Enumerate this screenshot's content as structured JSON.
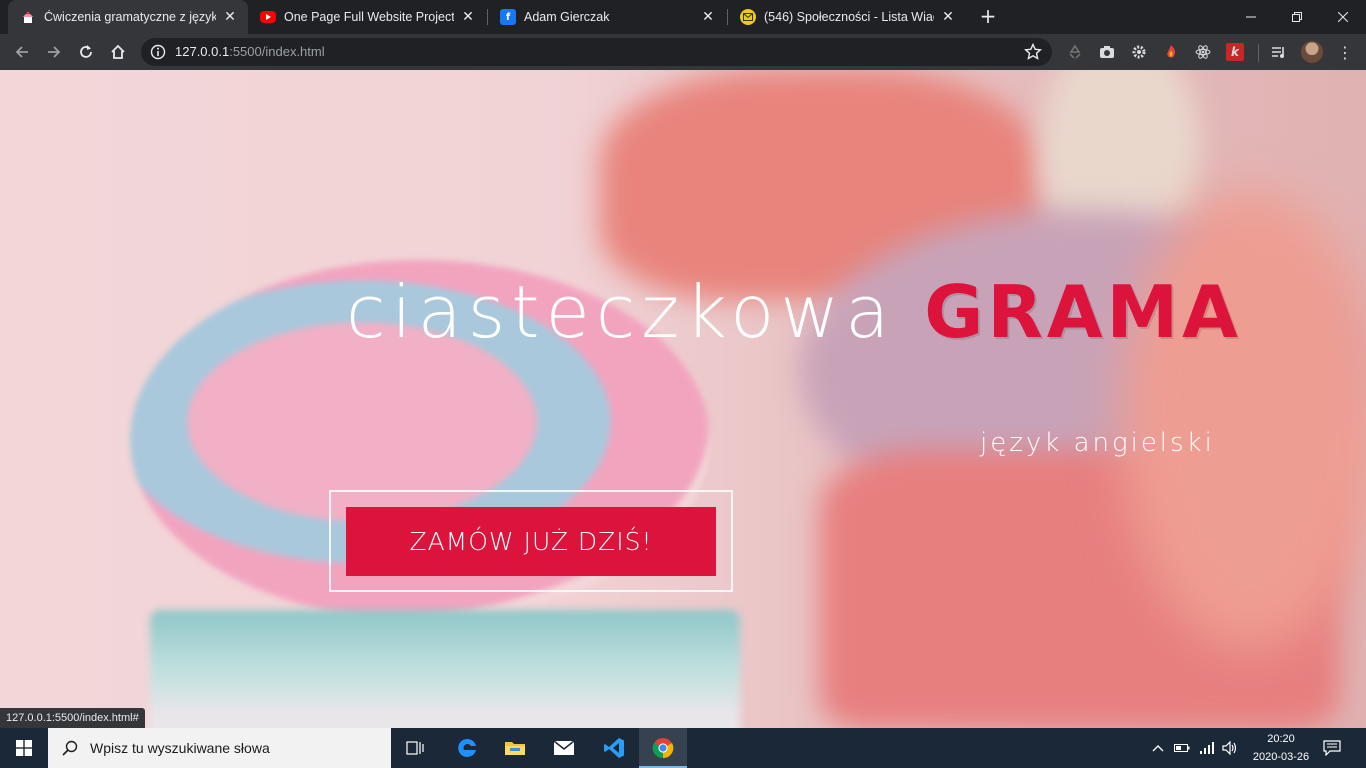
{
  "browser": {
    "tabs": [
      {
        "title": "Ćwiczenia gramatyczne z języka a",
        "icon": "cupcake-icon",
        "active": true
      },
      {
        "title": "One Page Full Website Project Fo",
        "icon": "youtube-icon",
        "active": false
      },
      {
        "title": "Adam Gierczak",
        "icon": "facebook-icon",
        "active": false
      },
      {
        "title": "(546) Społeczności - Lista Wiado",
        "icon": "mail-icon",
        "active": false
      }
    ],
    "new_tab": "+",
    "url_host": "127.0.0.1",
    "url_rest": ":5500/index.html"
  },
  "page": {
    "title_light": "ciasteczkowa",
    "title_bold": "GRAMA",
    "subtitle": "język angielski",
    "cta_label": "ZAMÓW JUŻ DZIŚ!",
    "accent_color": "#dc143c"
  },
  "status_url": "127.0.0.1:5500/index.html#",
  "taskbar": {
    "search_placeholder": "Wpisz tu wyszukiwane słowa",
    "time": "20:20",
    "date": "2020-03-26"
  }
}
